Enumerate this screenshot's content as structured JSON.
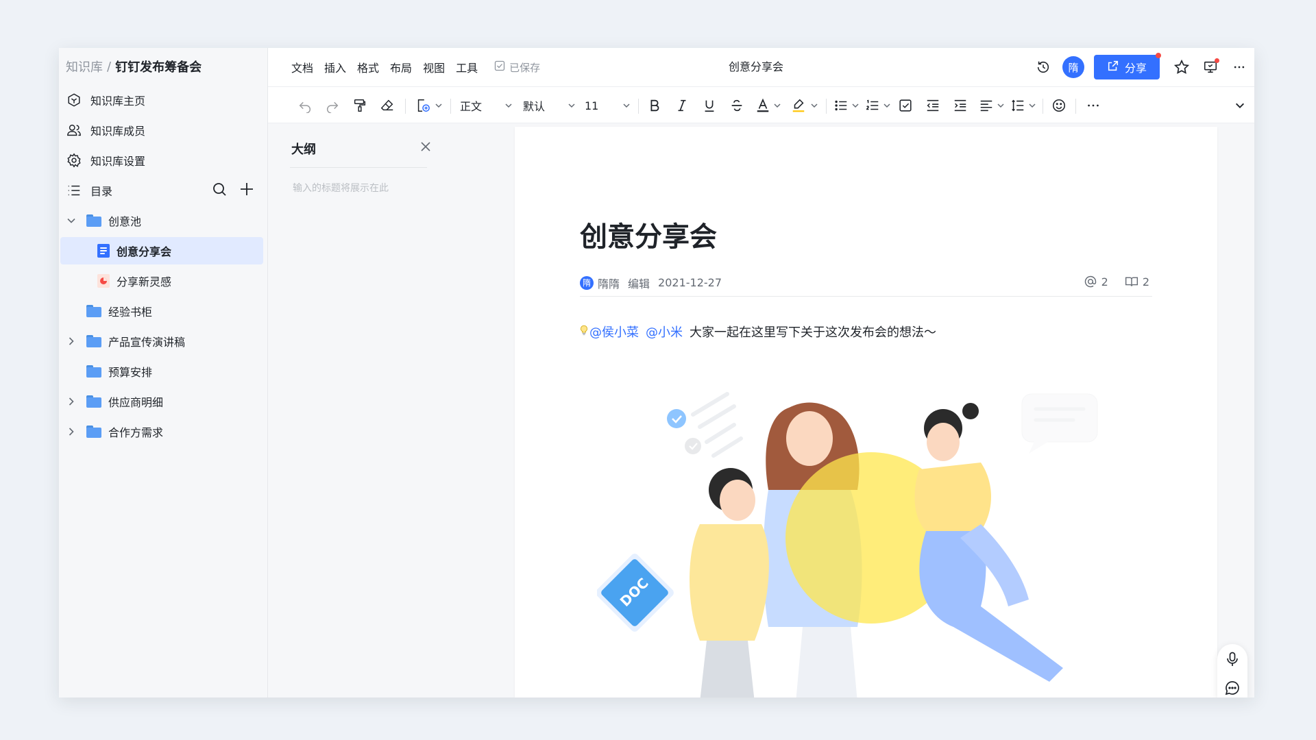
{
  "breadcrumb": {
    "root": "知识库",
    "separator": "/",
    "title": "钉钉发布筹备会"
  },
  "sidebar": {
    "nav": [
      {
        "label": "知识库主页",
        "icon": "home-hexagon-icon"
      },
      {
        "label": "知识库成员",
        "icon": "members-icon"
      },
      {
        "label": "知识库设置",
        "icon": "gear-icon"
      }
    ],
    "toc_label": "目录",
    "tree": [
      {
        "label": "创意池",
        "type": "folder",
        "expanded": true
      },
      {
        "label": "创意分享会",
        "type": "doc",
        "active": true
      },
      {
        "label": "分享新灵感",
        "type": "slides"
      },
      {
        "label": "经验书柜",
        "type": "folder"
      },
      {
        "label": "产品宣传演讲稿",
        "type": "folder",
        "collapsed": true
      },
      {
        "label": "预算安排",
        "type": "folder"
      },
      {
        "label": "供应商明细",
        "type": "folder",
        "collapsed": true
      },
      {
        "label": "合作方需求",
        "type": "folder",
        "collapsed": true
      }
    ]
  },
  "menubar": {
    "items": [
      "文档",
      "插入",
      "格式",
      "布局",
      "视图",
      "工具"
    ],
    "saved": "已保存",
    "doc_title": "创意分享会",
    "avatar": "隋",
    "share": "分享"
  },
  "toolbar": {
    "style": "正文",
    "font": "默认",
    "size": "11"
  },
  "outline": {
    "title": "大纲",
    "placeholder": "输入的标题将展示在此"
  },
  "document": {
    "title": "创意分享会",
    "author_avatar": "隋",
    "author": "隋隋",
    "action": "编辑",
    "date": "2021-12-27",
    "mentions_count": "2",
    "reads_count": "2",
    "mention_1": "@侯小菜",
    "mention_2": "@小米",
    "body": "大家一起在这里写下关于这次发布会的想法～",
    "illustration_badge": "DOC"
  },
  "colors": {
    "accent": "#3370ff",
    "sidebar_bg": "#f6f7f9",
    "active_item_bg": "#e1eaff",
    "folder": "#5b9df5",
    "notification": "#f54a45"
  }
}
